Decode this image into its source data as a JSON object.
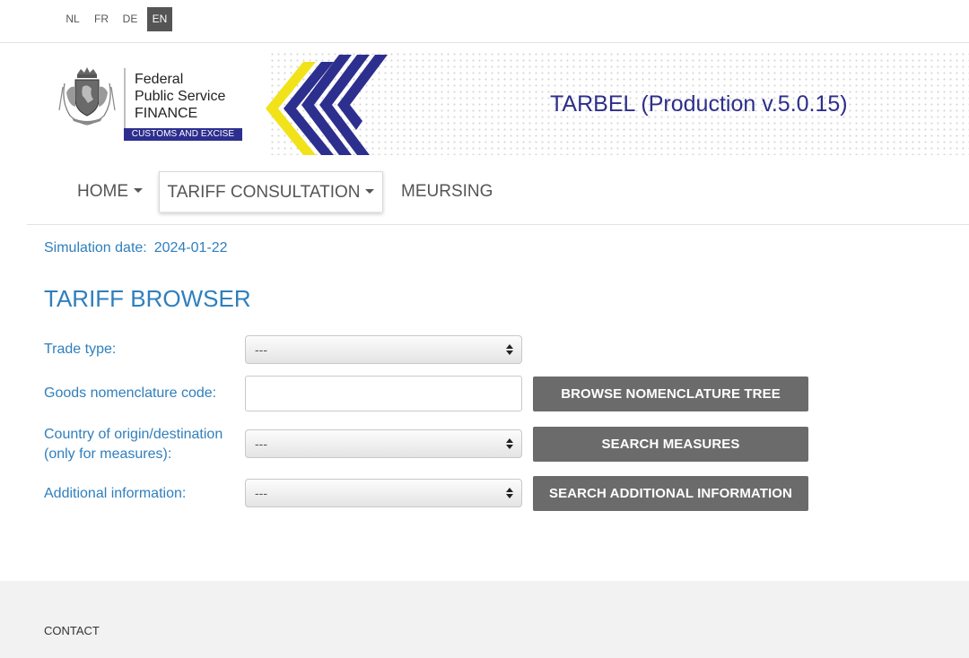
{
  "languages": [
    {
      "code": "NL",
      "active": false
    },
    {
      "code": "FR",
      "active": false
    },
    {
      "code": "DE",
      "active": false
    },
    {
      "code": "EN",
      "active": true
    }
  ],
  "header": {
    "logo_lines": [
      "Federal",
      "Public Service",
      "FINANCE"
    ],
    "logo_badge": "CUSTOMS AND EXCISE",
    "app_title": "TARBEL (Production v.5.0.15)"
  },
  "nav": {
    "home": "HOME",
    "tariff": "TARIFF CONSULTATION",
    "meursing": "MEURSING"
  },
  "simulation": {
    "label": "Simulation date:",
    "value": "2024-01-22"
  },
  "page_title": "TARIFF BROWSER",
  "form": {
    "trade_type": {
      "label": "Trade type:",
      "value": "---"
    },
    "goods_code": {
      "label": "Goods nomenclature code:",
      "value": ""
    },
    "country": {
      "label_line1": "Country of origin/destination",
      "label_line2": "(only for measures):",
      "value": "---"
    },
    "additional": {
      "label": "Additional information:",
      "value": "---"
    }
  },
  "buttons": {
    "browse_tree": "BROWSE NOMENCLATURE TREE",
    "search_measures": "SEARCH MEASURES",
    "search_additional": "SEARCH ADDITIONAL INFORMATION"
  },
  "footer": {
    "contact": "CONTACT"
  },
  "colors": {
    "accent_blue": "#2f7fbd",
    "title_purple": "#2e2f8a",
    "button_gray": "#6b6b6b",
    "chevron_yellow": "#f2e21a",
    "chevron_navy": "#2d2f8f"
  }
}
